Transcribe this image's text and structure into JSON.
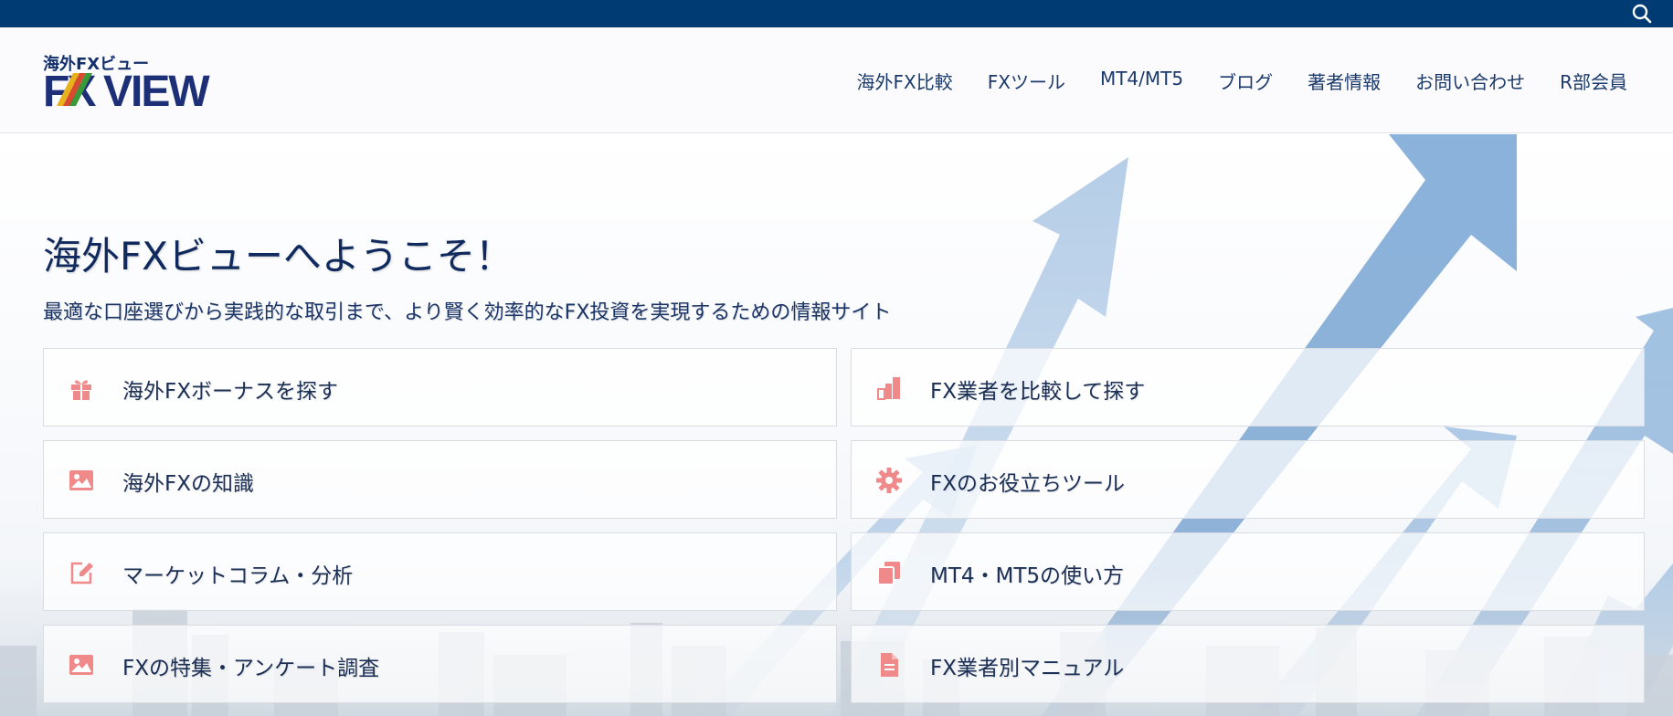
{
  "logo": {
    "small_text": "海外FXビュー",
    "main_text": "FXVIEW"
  },
  "nav": [
    {
      "label": "海外FX比較"
    },
    {
      "label": "FXツール"
    },
    {
      "label": "MT4/MT5"
    },
    {
      "label": "ブログ"
    },
    {
      "label": "著者情報"
    },
    {
      "label": "お問い合わせ"
    },
    {
      "label": "R部会員"
    }
  ],
  "hero": {
    "title": "海外FXビューへようこそ！",
    "subtitle": "最適な口座選びから実践的な取引まで、より賢く効率的なFX投資を実現するための情報サイト"
  },
  "menu": [
    {
      "label": "海外FXボーナスを探す",
      "icon": "gift-icon"
    },
    {
      "label": "FX業者を比較して探す",
      "icon": "bar-chart-icon"
    },
    {
      "label": "海外FXの知識",
      "icon": "image-icon"
    },
    {
      "label": "FXのお役立ちツール",
      "icon": "gear-icon"
    },
    {
      "label": "マーケットコラム・分析",
      "icon": "edit-icon"
    },
    {
      "label": "MT4・MT5の使い方",
      "icon": "copy-icon"
    },
    {
      "label": "FXの特集・アンケート調査",
      "icon": "image-icon"
    },
    {
      "label": "FX業者別マニュアル",
      "icon": "document-icon"
    }
  ],
  "colors": {
    "topbar": "#003c73",
    "accent_icon": "#f08a8a",
    "text_dark": "#1b2f55"
  }
}
